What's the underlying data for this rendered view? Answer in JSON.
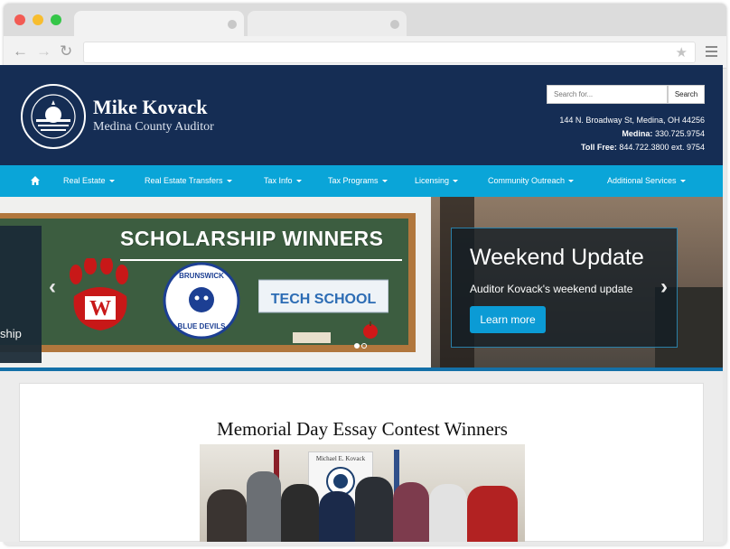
{
  "browser": {
    "url": ""
  },
  "header": {
    "title": "Mike Kovack",
    "subtitle": "Medina County Auditor",
    "seal_text": "AUDITORS OFFICE · MEDINA COUNTY · OHIO",
    "search": {
      "placeholder": "Search for...",
      "button_label": "Search"
    },
    "contact": {
      "address": "144 N. Broadway St, Medina, OH 44256",
      "medina_label": "Medina:",
      "medina_phone": "330.725.9754",
      "tollfree_label": "Toll Free:",
      "tollfree_phone": "844.722.3800 ext. 9754"
    }
  },
  "nav": {
    "items": [
      {
        "label": "Real Estate"
      },
      {
        "label": "Real Estate Transfers"
      },
      {
        "label": "Tax Info"
      },
      {
        "label": "Tax Programs"
      },
      {
        "label": "Licensing"
      },
      {
        "label": "Community Outreach"
      },
      {
        "label": "Additional Services"
      }
    ]
  },
  "carousel": {
    "left_slide": {
      "title": "SCHOLARSHIP WINNERS",
      "partial_caption": "ship",
      "logo_w": "W",
      "logo_brunswick": "BRUNSWICK",
      "logo_blue_devils": "BLUE DEVILS",
      "logo_tech": "TECH SCHOOL"
    },
    "active_slide": {
      "title": "Weekend Update",
      "subtitle": "Auditor Kovack's weekend update",
      "button_label": "Learn more"
    },
    "indicators": 2,
    "active_indicator": 1
  },
  "feature": {
    "title": "Memorial Day Essay Contest Winners",
    "banner_text": "Michael E. Kovack"
  },
  "colors": {
    "header_bg": "#152d54",
    "nav_bg": "#0aa5d8",
    "button_bg": "#0b9bd5"
  }
}
